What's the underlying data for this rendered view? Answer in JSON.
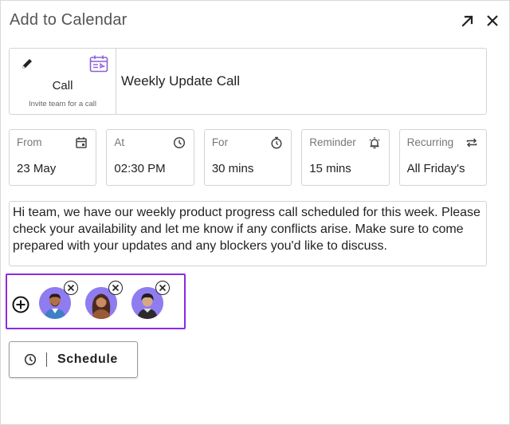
{
  "dialog": {
    "title": "Add to Calendar",
    "expand_icon": "arrow-up-right-icon",
    "close_icon": "close-icon"
  },
  "event_type": {
    "label": "Call",
    "subtitle": "Invite team for a call",
    "edit_icon": "pencil-icon",
    "calendar_icon": "calendar-icon"
  },
  "event_title": "Weekly Update Call",
  "fields": [
    {
      "key": "from",
      "label": "From",
      "value": "23 May",
      "icon": "calendar-icon"
    },
    {
      "key": "at",
      "label": "At",
      "value": "02:30 PM",
      "icon": "clock-icon"
    },
    {
      "key": "for",
      "label": "For",
      "value": "30 mins",
      "icon": "stopwatch-icon"
    },
    {
      "key": "reminder",
      "label": "Reminder",
      "value": "15 mins",
      "icon": "alarm-icon"
    },
    {
      "key": "recurring",
      "label": "Recurring",
      "value": "All Friday's",
      "icon": "repeat-icon"
    }
  ],
  "message": "Hi team, we have our weekly product progress call scheduled for this week. Please check your availability and let me know if any conflicts arise. Make sure to come prepared with your updates and any blockers you'd like to discuss.",
  "attendees": {
    "add_icon": "plus-circle-icon",
    "remove_icon": "close-circle-icon",
    "count": 3,
    "highlight_color": "#8a2be2"
  },
  "schedule_button": {
    "label": "Schedule",
    "icon": "clock-icon"
  },
  "colors": {
    "accent_purple": "#8a2be2",
    "calendar_icon": "#8c5fd6",
    "avatar_bg": "#8f7cf0",
    "border": "#d4d4d4"
  }
}
